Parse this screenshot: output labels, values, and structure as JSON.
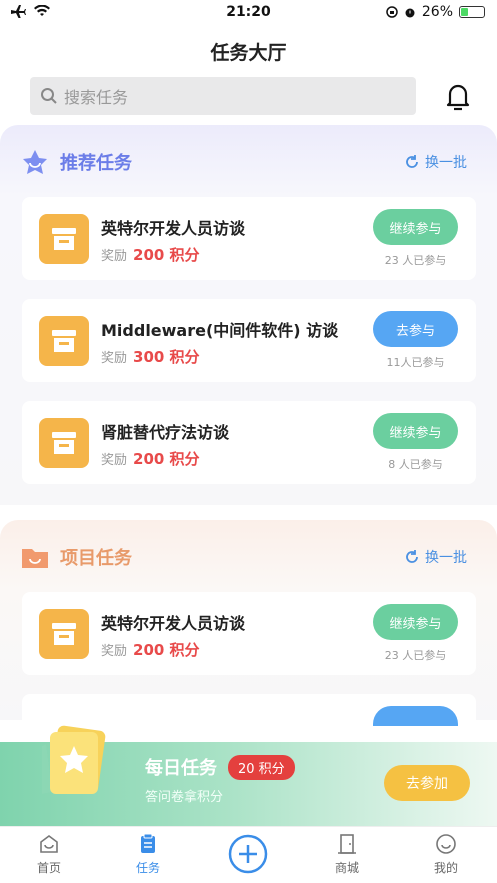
{
  "status": {
    "time": "21:20",
    "battery": "26%"
  },
  "header": {
    "title": "任务大厅"
  },
  "search": {
    "placeholder": "搜索任务"
  },
  "recommended": {
    "title": "推荐任务",
    "refresh": "换一批",
    "items": [
      {
        "name": "英特尔开发人员访谈",
        "reward_label": "奖励",
        "reward": "200 积分",
        "button": "继续参与",
        "count": "23 人已参与"
      },
      {
        "name": "Middleware(中间件软件) 访谈",
        "reward_label": "奖励",
        "reward": "300 积分",
        "button": "去参与",
        "count": "11人已参与"
      },
      {
        "name": "肾脏替代疗法访谈",
        "reward_label": "奖励",
        "reward": "200 积分",
        "button": "继续参与",
        "count": "8 人已参与"
      }
    ]
  },
  "project": {
    "title": "项目任务",
    "refresh": "换一批",
    "items": [
      {
        "name": "英特尔开发人员访谈",
        "reward_label": "奖励",
        "reward": "200 积分",
        "button": "继续参与",
        "count": "23 人已参与"
      }
    ]
  },
  "daily": {
    "title": "每日任务",
    "tag": "20 积分",
    "desc": "答问卷拿积分",
    "button": "去参加"
  },
  "tabs": [
    {
      "label": "首页",
      "icon": "home-icon"
    },
    {
      "label": "任务",
      "icon": "task-icon"
    },
    {
      "label": "",
      "icon": "plus-icon"
    },
    {
      "label": "商城",
      "icon": "door-icon"
    },
    {
      "label": "我的",
      "icon": "smile-icon"
    }
  ],
  "colors": {
    "accent": "#3a8de8",
    "reward": "#e84a4a",
    "green_button": "#6bcf9f",
    "blue_button": "#56a6f3",
    "join_button": "#f5c142"
  }
}
